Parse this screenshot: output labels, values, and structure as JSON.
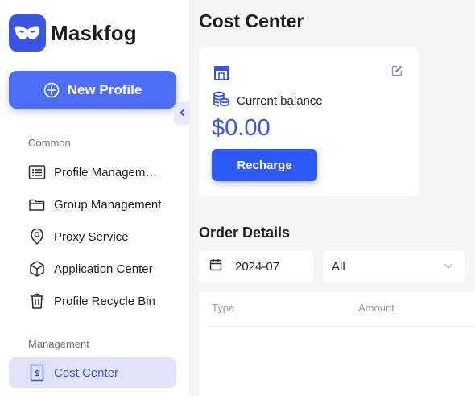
{
  "app": {
    "name": "Maskfog"
  },
  "sidebar": {
    "new_profile_label": "New Profile",
    "sections": {
      "common": "Common",
      "management": "Management"
    },
    "common_items": [
      {
        "label": "Profile Management",
        "icon": "list-icon"
      },
      {
        "label": "Group Management",
        "icon": "folder-icon"
      },
      {
        "label": "Proxy Service",
        "icon": "location-pin-icon"
      },
      {
        "label": "Application Center",
        "icon": "cube-icon"
      },
      {
        "label": "Profile Recycle Bin",
        "icon": "trash-icon"
      }
    ],
    "management_items": [
      {
        "label": "Cost Center",
        "icon": "receipt-dollar-icon",
        "active": true
      }
    ]
  },
  "main": {
    "title": "Cost Center",
    "balance_card": {
      "label": "Current balance",
      "amount": "$0.00",
      "recharge_label": "Recharge"
    },
    "orders": {
      "title": "Order Details",
      "date_value": "2024-07",
      "filter_value": "All",
      "columns": [
        "Type",
        "Amount"
      ]
    }
  },
  "colors": {
    "accent": "#3a55e6",
    "button": "#2d59f5",
    "active_bg": "#dfe4fb"
  }
}
